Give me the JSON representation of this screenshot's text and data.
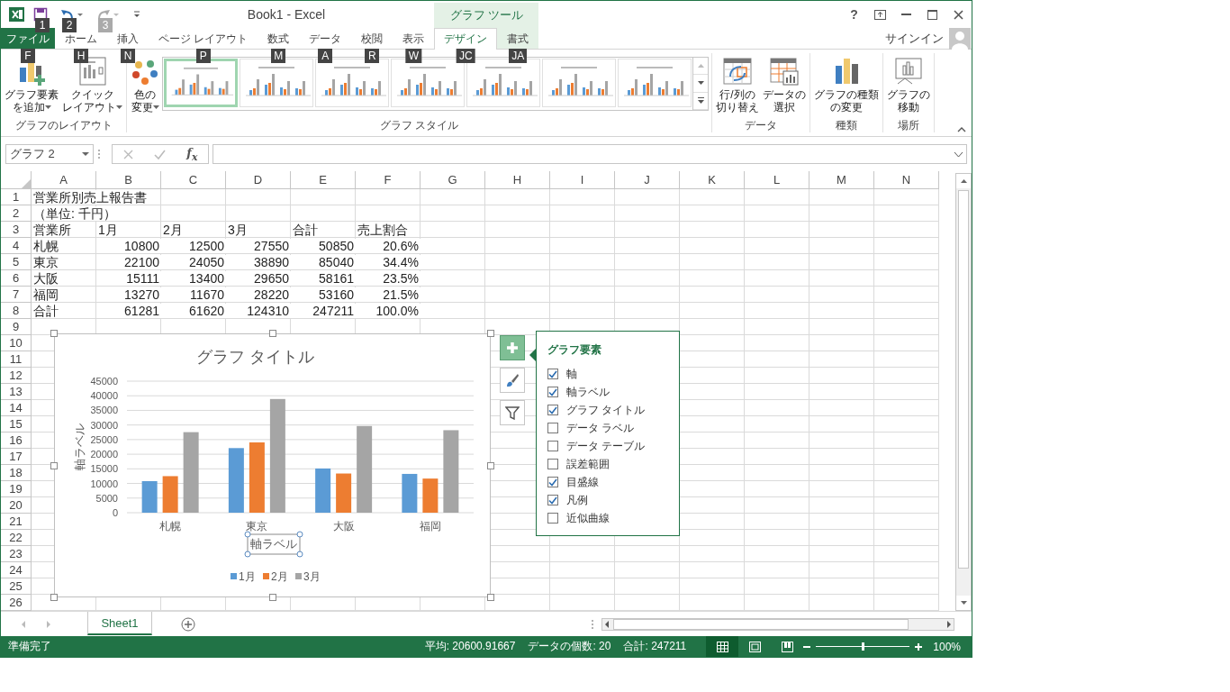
{
  "window": {
    "title": "Book1 - Excel",
    "contextual_tab_group": "グラフ ツール",
    "sign_in": "サインイン",
    "controls": [
      {
        "kind": "help",
        "text": "?"
      },
      {
        "kind": "ribbon-display"
      },
      {
        "kind": "minimize"
      },
      {
        "kind": "maximize"
      },
      {
        "kind": "close"
      }
    ]
  },
  "quick_access": [
    {
      "kind": "save",
      "keytip": "1",
      "disabled": false
    },
    {
      "kind": "undo",
      "keytip": "2",
      "disabled": false
    },
    {
      "kind": "redo",
      "keytip": "3",
      "disabled": true
    }
  ],
  "tabs": [
    {
      "label": "ファイル",
      "keytip": "F",
      "kind": "file",
      "selected": false
    },
    {
      "label": "ホーム",
      "keytip": "H",
      "kind": "normal",
      "selected": false
    },
    {
      "label": "挿入",
      "keytip": "N",
      "kind": "normal",
      "selected": false
    },
    {
      "label": "ページ レイアウト",
      "keytip": "P",
      "kind": "normal",
      "selected": false
    },
    {
      "label": "数式",
      "keytip": "M",
      "kind": "normal",
      "selected": false
    },
    {
      "label": "データ",
      "keytip": "A",
      "kind": "normal",
      "selected": false
    },
    {
      "label": "校閲",
      "keytip": "R",
      "kind": "normal",
      "selected": false
    },
    {
      "label": "表示",
      "keytip": "W",
      "kind": "normal",
      "selected": false
    },
    {
      "label": "デザイン",
      "keytip": "JC",
      "kind": "contextual",
      "selected": true
    },
    {
      "label": "書式",
      "keytip": "JA",
      "kind": "contextual",
      "selected": false
    }
  ],
  "ribbon": {
    "groups": [
      {
        "label": "グラフのレイアウト",
        "items": [
          {
            "kind": "add-element",
            "lines": [
              "グラフ要素",
              "を追加"
            ],
            "dropdown": true
          },
          {
            "kind": "quick-layout",
            "lines": [
              "クイック",
              "レイアウト"
            ],
            "dropdown": true
          }
        ]
      },
      {
        "label": "グラフ スタイル",
        "items": [
          {
            "kind": "colors",
            "lines": [
              "色の",
              "変更"
            ],
            "dropdown": true
          },
          {
            "kind": "gallery",
            "thumbnails": [
              {
                "selected": true
              },
              {
                "selected": false
              },
              {
                "selected": false
              },
              {
                "selected": false
              },
              {
                "selected": false
              },
              {
                "selected": false
              },
              {
                "selected": false
              }
            ]
          }
        ]
      },
      {
        "label": "データ",
        "items": [
          {
            "kind": "switch-row-column",
            "lines": [
              "行/列の",
              "切り替え"
            ],
            "dropdown": false
          },
          {
            "kind": "select-data",
            "lines": [
              "データの",
              "選択"
            ],
            "dropdown": false
          }
        ]
      },
      {
        "label": "種類",
        "items": [
          {
            "kind": "change-type",
            "lines": [
              "グラフの種類",
              "の変更"
            ],
            "dropdown": false
          }
        ]
      },
      {
        "label": "場所",
        "items": [
          {
            "kind": "move-chart",
            "lines": [
              "グラフの",
              "移動"
            ],
            "dropdown": false
          }
        ]
      }
    ]
  },
  "formula_bar": {
    "name_box": "グラフ 2",
    "insert_function": "f$_{x}$"
  },
  "sheet": {
    "columns": [
      "A",
      "B",
      "C",
      "D",
      "E",
      "F",
      "G",
      "H",
      "I",
      "J",
      "K",
      "L",
      "M",
      "N"
    ],
    "rows": [
      {
        "number": "1",
        "kind": "text",
        "cells": [
          "営業所別売上報告書"
        ]
      },
      {
        "number": "2",
        "kind": "text",
        "cells": [
          "（単位: 千円）"
        ]
      },
      {
        "number": "3",
        "kind": "text",
        "cells": [
          "営業所",
          "1月",
          "2月",
          "3月",
          "合計",
          "売上割合"
        ]
      },
      {
        "number": "4",
        "kind": "values",
        "cells": [
          "札幌",
          "10800",
          "12500",
          "27550",
          "50850",
          "20.6%"
        ]
      },
      {
        "number": "5",
        "kind": "values",
        "cells": [
          "東京",
          "22100",
          "24050",
          "38890",
          "85040",
          "34.4%"
        ]
      },
      {
        "number": "6",
        "kind": "values",
        "cells": [
          "大阪",
          "15111",
          "13400",
          "29650",
          "58161",
          "23.5%"
        ]
      },
      {
        "number": "7",
        "kind": "values",
        "cells": [
          "福岡",
          "13270",
          "11670",
          "28220",
          "53160",
          "21.5%"
        ]
      },
      {
        "number": "8",
        "kind": "values",
        "cells": [
          "合計",
          "61281",
          "61620",
          "124310",
          "247211",
          "100.0%"
        ]
      },
      {
        "number": "9"
      },
      {
        "number": "10"
      },
      {
        "number": "11"
      },
      {
        "number": "12"
      },
      {
        "number": "13"
      },
      {
        "number": "14"
      },
      {
        "number": "15"
      },
      {
        "number": "16"
      },
      {
        "number": "17"
      },
      {
        "number": "18"
      },
      {
        "number": "19"
      },
      {
        "number": "20"
      },
      {
        "number": "21"
      },
      {
        "number": "22"
      },
      {
        "number": "23"
      },
      {
        "number": "24"
      },
      {
        "number": "25"
      },
      {
        "number": "26"
      }
    ]
  },
  "chart": {
    "chart_data": {
      "type": "bar",
      "title": "グラフ タイトル",
      "xlabel": "軸ラベル",
      "ylabel": "軸ラベル",
      "categories": [
        "札幌",
        "東京",
        "大阪",
        "福岡"
      ],
      "series": [
        {
          "name": "1月",
          "color": "#5b9bd5",
          "values": [
            10800,
            22100,
            15111,
            13270
          ]
        },
        {
          "name": "2月",
          "color": "#ed7d31",
          "values": [
            12500,
            24050,
            13400,
            11670
          ]
        },
        {
          "name": "3月",
          "color": "#a5a5a5",
          "values": [
            27550,
            38890,
            29650,
            28220
          ]
        }
      ],
      "ylim": [
        0,
        45000
      ],
      "yticks": [
        0,
        5000,
        10000,
        15000,
        20000,
        25000,
        30000,
        35000,
        40000,
        45000
      ],
      "grid": true,
      "legend": true
    },
    "side_buttons": [
      {
        "kind": "elements",
        "selected": true
      },
      {
        "kind": "styles",
        "selected": false
      },
      {
        "kind": "filter",
        "selected": false
      }
    ],
    "elements_panel": {
      "title": "グラフ要素",
      "items": [
        {
          "label": "軸",
          "checked": true
        },
        {
          "label": "軸ラベル",
          "checked": true
        },
        {
          "label": "グラフ タイトル",
          "checked": true
        },
        {
          "label": "データ ラベル",
          "checked": false
        },
        {
          "label": "データ テーブル",
          "checked": false
        },
        {
          "label": "誤差範囲",
          "checked": false
        },
        {
          "label": "目盛線",
          "checked": true
        },
        {
          "label": "凡例",
          "checked": true
        },
        {
          "label": "近似曲線",
          "checked": false
        }
      ]
    }
  },
  "sheet_tabs": [
    {
      "label": "Sheet1",
      "selected": true
    }
  ],
  "status_bar": {
    "status": "準備完了",
    "stats": [
      "平均: 20600.91667",
      "データの個数: 20",
      "合計: 247211"
    ],
    "views": [
      {
        "kind": "normal",
        "selected": true
      },
      {
        "kind": "page-layout",
        "selected": false
      },
      {
        "kind": "page-break",
        "selected": false
      }
    ],
    "zoom": {
      "level": 0.5,
      "reading": "100%"
    }
  }
}
